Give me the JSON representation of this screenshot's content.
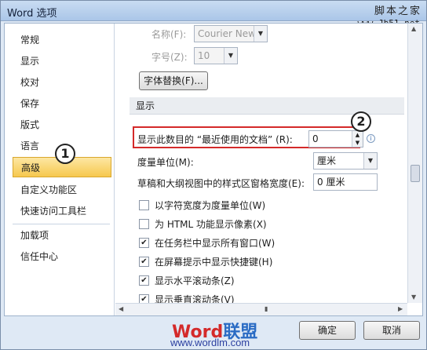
{
  "window": {
    "title": "Word 选项"
  },
  "watermark": {
    "site": "脚本之家",
    "url": "www.Jb51.net"
  },
  "nav": {
    "items": [
      {
        "label": "常规"
      },
      {
        "label": "显示"
      },
      {
        "label": "校对"
      },
      {
        "label": "保存"
      },
      {
        "label": "版式"
      },
      {
        "label": "语言"
      },
      {
        "label": "高级"
      },
      {
        "label": "自定义功能区"
      },
      {
        "label": "快速访问工具栏"
      },
      {
        "label": "加载项"
      },
      {
        "label": "信任中心"
      }
    ],
    "active": "高级"
  },
  "font": {
    "name_label": "名称(F):",
    "name_value": "Courier New",
    "size_label": "字号(Z):",
    "size_value": "10",
    "substitute_button": "字体替换(F)..."
  },
  "display": {
    "section_title": "显示",
    "recent_docs_label": "显示此数目的 “最近使用的文档” (R):",
    "recent_docs_value": "0",
    "units_label": "度量单位(M):",
    "units_value": "厘米",
    "pane_width_label": "草稿和大纲视图中的样式区窗格宽度(E):",
    "pane_width_value": "0 厘米",
    "options": [
      {
        "label": "以字符宽度为度量单位(W)",
        "checked": false
      },
      {
        "label": "为 HTML 功能显示像素(X)",
        "checked": false
      },
      {
        "label": "在任务栏中显示所有窗口(W)",
        "checked": true
      },
      {
        "label": "在屏幕提示中显示快捷键(H)",
        "checked": true
      },
      {
        "label": "显示水平滚动条(Z)",
        "checked": true
      },
      {
        "label": "显示垂直滚动条(V)",
        "checked": true
      }
    ]
  },
  "annotations": {
    "badge1": "1",
    "badge2": "2"
  },
  "footer": {
    "ok": "确定",
    "cancel": "取消",
    "brand_word": "Word",
    "brand_cn": "联盟",
    "brand_url": "www.wordlm.com"
  },
  "colors": {
    "accent": "#f6c84e",
    "highlight": "#d42a2a",
    "brand": "#2b6cc4"
  }
}
